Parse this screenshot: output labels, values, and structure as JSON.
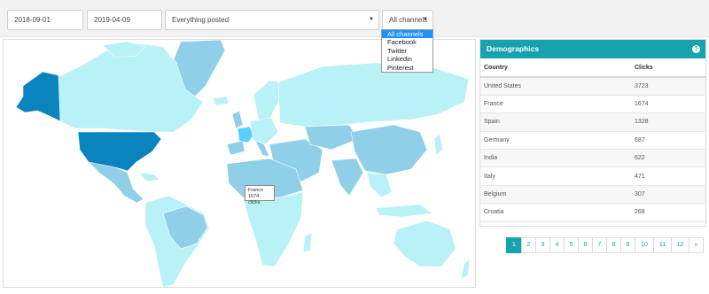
{
  "filters": {
    "start_date": "2018-09-01",
    "end_date": "2019-04-09",
    "content_filter": "Everything posted",
    "channel_filter": "All channels"
  },
  "channel_dropdown": {
    "options": [
      "All channels",
      "Facebook",
      "Twitter",
      "Linkedin",
      "Pinterest"
    ],
    "selected": "All channels"
  },
  "map": {
    "tooltip": {
      "country": "France",
      "clicks": "1674 clicks"
    },
    "colors": {
      "high": "#0a84bf",
      "mid": "#8fd0e8",
      "low": "#b8f1f6",
      "hover": "#56d2ff",
      "none": "#c8f4f7"
    }
  },
  "demographics": {
    "title": "Demographics",
    "help_icon": "question-circle-icon",
    "headers": [
      "Country",
      "Clicks"
    ],
    "rows": [
      {
        "country": "United States",
        "clicks": "3723"
      },
      {
        "country": "France",
        "clicks": "1674"
      },
      {
        "country": "Spain",
        "clicks": "1328"
      },
      {
        "country": "Germany",
        "clicks": "687"
      },
      {
        "country": "India",
        "clicks": "622"
      },
      {
        "country": "Italy",
        "clicks": "471"
      },
      {
        "country": "Belgium",
        "clicks": "307"
      },
      {
        "country": "Croatia",
        "clicks": "268"
      }
    ]
  },
  "pagination": {
    "pages": [
      "1",
      "2",
      "3",
      "4",
      "5",
      "6",
      "7",
      "8",
      "9",
      "10",
      "11",
      "12",
      "»"
    ],
    "current": "1"
  },
  "accent_color": "#17a2b0"
}
